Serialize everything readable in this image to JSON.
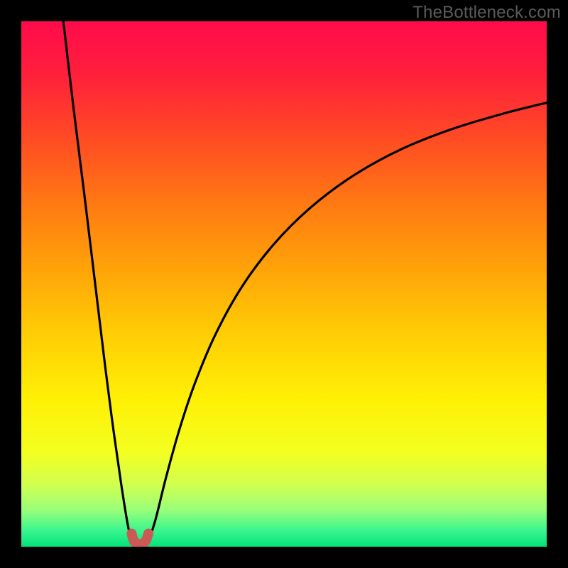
{
  "watermark": "TheBottleneck.com",
  "gradient": {
    "stops": [
      {
        "offset": 0.0,
        "color": "#ff0b4b"
      },
      {
        "offset": 0.1,
        "color": "#ff1f3c"
      },
      {
        "offset": 0.22,
        "color": "#ff4a24"
      },
      {
        "offset": 0.35,
        "color": "#ff7a12"
      },
      {
        "offset": 0.48,
        "color": "#ffa608"
      },
      {
        "offset": 0.6,
        "color": "#ffcf05"
      },
      {
        "offset": 0.72,
        "color": "#fff005"
      },
      {
        "offset": 0.82,
        "color": "#f3ff20"
      },
      {
        "offset": 0.88,
        "color": "#d2ff4e"
      },
      {
        "offset": 0.93,
        "color": "#9aff7a"
      },
      {
        "offset": 0.97,
        "color": "#38f58f"
      },
      {
        "offset": 1.0,
        "color": "#05e27a"
      }
    ]
  },
  "chart_data": {
    "type": "line",
    "title": "",
    "xlabel": "",
    "ylabel": "",
    "xlim": [
      0,
      100
    ],
    "ylim": [
      0,
      100
    ],
    "note": "y-axis inverted: 0 (good/green) at bottom, 100 (bad/red) at top; values estimated from pixels",
    "series": [
      {
        "name": "left-branch",
        "x": [
          8.0,
          10.0,
          12.0,
          14.0,
          16.0,
          17.5,
          19.0,
          20.3,
          21.2
        ],
        "y": [
          100.0,
          83.0,
          67.0,
          50.5,
          34.0,
          22.5,
          12.0,
          4.0,
          0.5
        ]
      },
      {
        "name": "right-branch",
        "x": [
          24.0,
          25.5,
          27.5,
          30.0,
          33.0,
          37.0,
          42.0,
          48.0,
          55.0,
          63.0,
          72.0,
          82.0,
          92.0,
          100.0
        ],
        "y": [
          0.5,
          5.0,
          13.0,
          22.0,
          31.0,
          40.5,
          49.5,
          57.5,
          64.5,
          70.5,
          75.5,
          79.5,
          82.5,
          84.5
        ]
      }
    ],
    "marker": {
      "name": "valley-marker",
      "color": "#cb5a55",
      "points_xy": [
        [
          21.0,
          2.5
        ],
        [
          21.5,
          1.0
        ],
        [
          22.6,
          0.5
        ],
        [
          23.6,
          1.0
        ],
        [
          24.2,
          2.5
        ]
      ]
    }
  }
}
